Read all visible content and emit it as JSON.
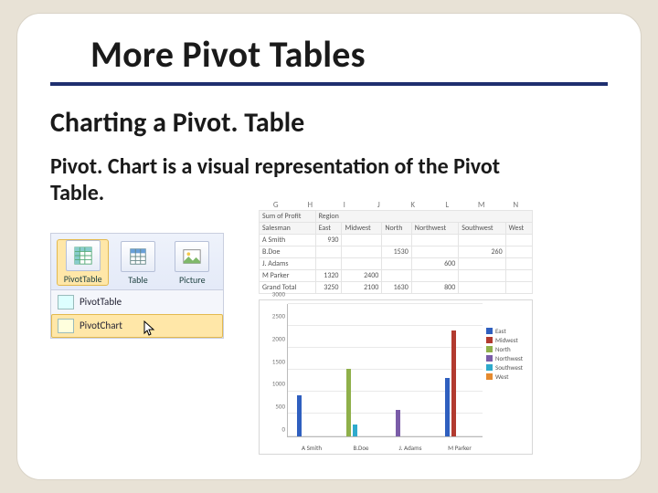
{
  "slide": {
    "title": "More Pivot Tables",
    "subtitle": "Charting a Pivot. Table",
    "body": "Pivot. Chart is a visual representation of the Pivot Table."
  },
  "ribbon": {
    "item0": {
      "label": "PivotTable",
      "icon": "pivottable-icon"
    },
    "item1": {
      "label": "Table",
      "icon": "table-icon"
    },
    "item2": {
      "label": "Picture",
      "icon": "picture-icon"
    },
    "menu0": "PivotTable",
    "menu1": "PivotChart"
  },
  "spreadsheet_cols": [
    "G",
    "H",
    "I",
    "J",
    "K",
    "L",
    "M",
    "N"
  ],
  "pivot": {
    "corner": "Sum of Profit",
    "region_label": "Region",
    "row_label": "Salesman",
    "regions": [
      "East",
      "Midwest",
      "North",
      "Northwest",
      "Southwest",
      "West"
    ],
    "rows": [
      {
        "name": "A Smith",
        "vals": [
          "930",
          "",
          "",
          "",
          "",
          ""
        ]
      },
      {
        "name": "B.Doe",
        "vals": [
          "",
          "",
          "1530",
          "",
          "260",
          ""
        ]
      },
      {
        "name": "J. Adams",
        "vals": [
          "",
          "",
          "",
          "600",
          "",
          ""
        ]
      },
      {
        "name": "M Parker",
        "vals": [
          "1320",
          "2400",
          "",
          "",
          "",
          ""
        ]
      }
    ],
    "grand": {
      "name": "Grand Total",
      "vals": [
        "3250",
        "2100",
        "1630",
        "800",
        "",
        "",
        ""
      ]
    }
  },
  "chart_data": {
    "type": "bar",
    "categories": [
      "A Smith",
      "B.Doe",
      "J. Adams",
      "M Parker"
    ],
    "series": [
      {
        "name": "East",
        "color": "#2f5fbf",
        "values": [
          930,
          0,
          0,
          1320
        ]
      },
      {
        "name": "Midwest",
        "color": "#b23a2f",
        "values": [
          0,
          0,
          0,
          2400
        ]
      },
      {
        "name": "North",
        "color": "#8fb04a",
        "values": [
          0,
          1530,
          0,
          0
        ]
      },
      {
        "name": "Northwest",
        "color": "#7a5ca8",
        "values": [
          0,
          0,
          600,
          0
        ]
      },
      {
        "name": "Southwest",
        "color": "#2faacc",
        "values": [
          0,
          260,
          0,
          0
        ]
      },
      {
        "name": "West",
        "color": "#e58a2f",
        "values": [
          0,
          0,
          0,
          0
        ]
      }
    ],
    "ylim": [
      0,
      3000
    ],
    "yticks": [
      0,
      500,
      1000,
      1500,
      2000,
      2500,
      3000
    ],
    "title": "",
    "xlabel": "",
    "ylabel": ""
  }
}
